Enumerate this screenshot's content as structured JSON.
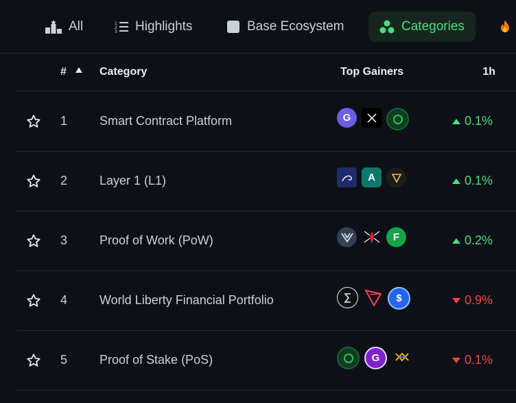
{
  "tabs": [
    {
      "label": "All",
      "icon": "podium-icon"
    },
    {
      "label": "Highlights",
      "icon": "list-icon"
    },
    {
      "label": "Base Ecosystem",
      "icon": "base-logo-icon"
    },
    {
      "label": "Categories",
      "icon": "triangle-circles-icon",
      "active": true
    },
    {
      "label": "",
      "icon": "fire-icon"
    }
  ],
  "header": {
    "rank": "#",
    "category": "Category",
    "top_gainers": "Top Gainers",
    "change_1h": "1h"
  },
  "rows": [
    {
      "rank": "1",
      "category": "Smart Contract Platform",
      "change": "0.1%",
      "direction": "up",
      "coins": [
        "G",
        "",
        ""
      ]
    },
    {
      "rank": "2",
      "category": "Layer 1 (L1)",
      "change": "0.1%",
      "direction": "up",
      "coins": [
        "",
        "A",
        ""
      ]
    },
    {
      "rank": "3",
      "category": "Proof of Work (PoW)",
      "change": "0.2%",
      "direction": "up",
      "coins": [
        "",
        "",
        "F"
      ]
    },
    {
      "rank": "4",
      "category": "World Liberty Financial Portfolio",
      "change": "0.9%",
      "direction": "down",
      "coins": [
        "",
        "",
        "$"
      ]
    },
    {
      "rank": "5",
      "category": "Proof of Stake (PoS)",
      "change": "0.1%",
      "direction": "down",
      "coins": [
        "",
        "G",
        ""
      ]
    }
  ],
  "colors": {
    "accent": "#4ade80",
    "negative": "#ef4444",
    "background": "#0d1117"
  }
}
